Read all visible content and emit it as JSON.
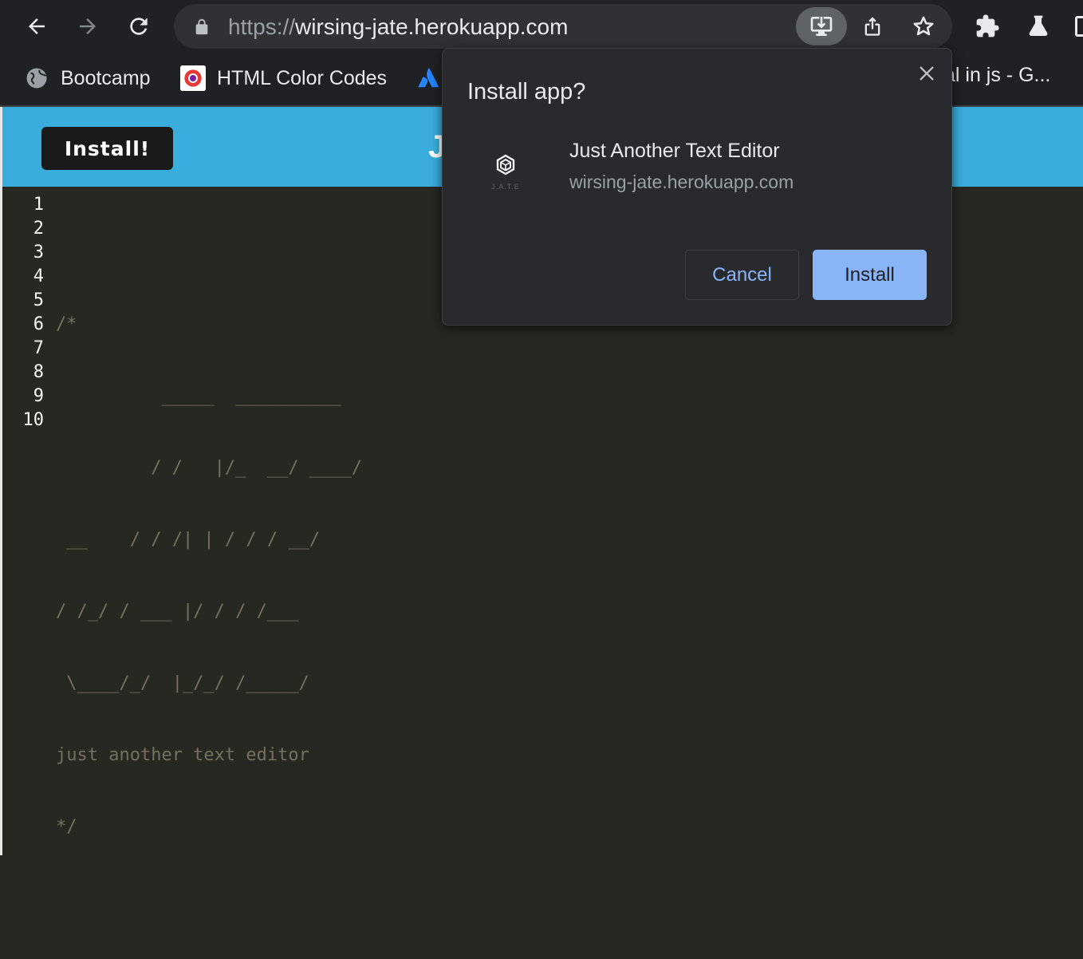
{
  "browser": {
    "url_scheme": "https://",
    "url_host": "wirsing-jate.herokuapp.com",
    "bookmarks": [
      {
        "label": "Bootcamp",
        "icon": "globe-icon"
      },
      {
        "label": "HTML Color Codes",
        "icon": "html-color-codes-icon"
      },
      {
        "label": "",
        "icon": "atlassian-icon"
      }
    ],
    "bookmark_truncated": "al in js - G..."
  },
  "page": {
    "install_button_label": "Install!",
    "header_title_partial": "J",
    "header_color": "#3aaddd"
  },
  "editor": {
    "line_numbers": [
      "1",
      "2",
      "3",
      "4",
      "5",
      "6",
      "7",
      "8",
      "9",
      "10"
    ],
    "lines": [
      "",
      "/*",
      "          _____  __________",
      "         / /   |/_  __/ ____/",
      " __    / / /| | / / / __/",
      "/ /_/ / ___ |/ / / /___",
      " \\____/_/  |_/_/ /_____/",
      "just another text editor",
      "*/",
      ""
    ]
  },
  "dialog": {
    "title": "Install app?",
    "app_name": "Just Another Text Editor",
    "app_origin": "wirsing-jate.herokuapp.com",
    "app_icon_label": "J.A.T.E",
    "cancel_label": "Cancel",
    "install_label": "Install",
    "accent_color": "#8ab4f8"
  }
}
